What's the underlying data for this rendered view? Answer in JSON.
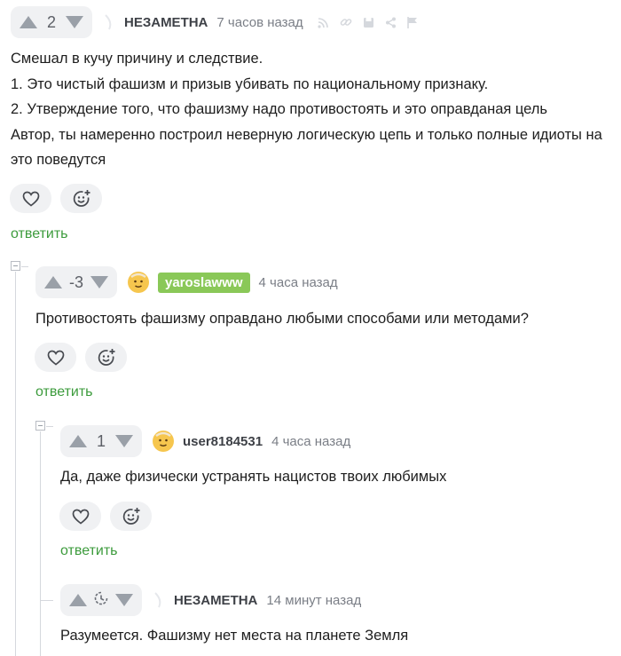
{
  "comments": [
    {
      "score": "2",
      "username": "НЕЗАМЕТНА",
      "time": "7 часов назад",
      "lines": [
        "Смешал в кучу причину и следствие.",
        "1. Это чистый фашизм и призыв убивать по национальному признаку.",
        "2. Утверждение того, что фашизму надо противостоять и это оправданая цель",
        "Автор, ты намеренно построил неверную логическую цепь и только полные идиоты на",
        "это поведутся"
      ],
      "reply": "ответить"
    },
    {
      "score": "-3",
      "username": "yaroslawww",
      "time": "4 часа назад",
      "lines": [
        "Противостоять фашизму оправдано любыми способами или методами?"
      ],
      "reply": "ответить"
    },
    {
      "score": "1",
      "username": "user8184531",
      "time": "4 часа назад",
      "lines": [
        "Да, даже физически устранять нацистов твоих любимых"
      ],
      "reply": "ответить"
    },
    {
      "score": "",
      "username": "НЕЗАМЕТНА",
      "time": "14 минут назад",
      "lines": [
        "Разумеется. Фашизму нет места на планете Земля"
      ]
    }
  ],
  "icons": {
    "upvote": "triangle-up-icon",
    "downvote": "triangle-down-icon",
    "pending": "clock-icon",
    "like": "heart-icon",
    "reaction": "add-emoji-icon",
    "tools": [
      "rss-icon",
      "link-icon",
      "save-icon",
      "share-icon",
      "flag-icon"
    ]
  },
  "colors": {
    "reply_link": "#3c9b3c",
    "badge": "#8ac858",
    "vote_bg": "#f0f1f3"
  }
}
